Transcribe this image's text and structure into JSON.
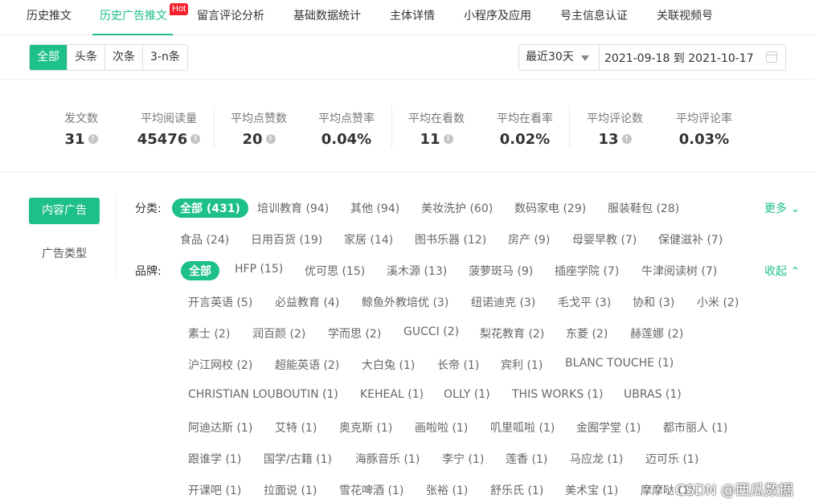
{
  "top_tabs": [
    "历史推文",
    "历史广告推文",
    "留言评论分析",
    "基础数据统计",
    "主体详情",
    "小程序及应用",
    "号主信息认证",
    "关联视频号"
  ],
  "hot_badge": "Hot",
  "segment": [
    "全部",
    "头条",
    "次条",
    "3-n条"
  ],
  "date": {
    "preset": "最近30天",
    "range": "2021-09-18 到 2021-10-17"
  },
  "stats": [
    {
      "label": "发文数",
      "value": "31"
    },
    {
      "label": "平均阅读量",
      "value": "45476"
    },
    {
      "label": "平均点赞数",
      "value": "20"
    },
    {
      "label": "平均点赞率",
      "value": "0.04%"
    },
    {
      "label": "平均在看数",
      "value": "11"
    },
    {
      "label": "平均在看率",
      "value": "0.02%"
    },
    {
      "label": "平均评论数",
      "value": "13"
    },
    {
      "label": "平均评论率",
      "value": "0.03%"
    }
  ],
  "info_icon": "!",
  "left": {
    "ad_btn": "内容广告",
    "ad_type": "广告类型"
  },
  "category": {
    "label": "分类:",
    "more": "更多",
    "items": [
      "全部 (431)",
      "培训教育 (94)",
      "其他 (94)",
      "美妆洗护 (60)",
      "数码家电 (29)",
      "服装鞋包 (28)",
      "食品 (24)",
      "日用百货 (19)",
      "家居 (14)",
      "图书乐器 (12)",
      "房产 (9)",
      "母婴早教 (7)",
      "保健滋补 (7)"
    ]
  },
  "brand": {
    "label": "品牌:",
    "collapse": "收起",
    "items": [
      "全部",
      "HFP (15)",
      "优可思 (15)",
      "溪木源 (13)",
      "菠萝斑马 (9)",
      "插座学院 (7)",
      "牛津阅读树 (7)",
      "开言英语 (5)",
      "必益教育 (4)",
      "鲸鱼外教培优 (3)",
      "纽诺迪克 (3)",
      "毛戈平 (3)",
      "协和 (3)",
      "小米 (2)",
      "素士 (2)",
      "润百颜 (2)",
      "学而思 (2)",
      "GUCCI (2)",
      "梨花教育 (2)",
      "东菱 (2)",
      "赫莲娜 (2)",
      "沪江网校 (2)",
      "超能英语 (2)",
      "大白兔 (1)",
      "长帝 (1)",
      "宾利 (1)",
      "BLANC TOUCHE (1)",
      "CHRISTIAN LOUBOUTIN (1)",
      "KEHEAL (1)",
      "OLLY (1)",
      "THIS WORKS (1)",
      "UBRAS (1)",
      "阿迪达斯 (1)",
      "艾特 (1)",
      "奥克斯 (1)",
      "画啦啦 (1)",
      "叽里呱啦 (1)",
      "金囿学堂 (1)",
      "都市丽人 (1)",
      "跟谁学 (1)",
      "国学/古籍 (1)",
      "海豚音乐 (1)",
      "李宁 (1)",
      "莲香 (1)",
      "马应龙 (1)",
      "迈可乐 (1)",
      "开课吧 (1)",
      "拉面说 (1)",
      "雪花啤酒 (1)",
      "张裕 (1)",
      "舒乐氏 (1)",
      "美术宝 (1)",
      "摩摩哒 (1)"
    ]
  },
  "watermark": "CSDN @西瓜数据"
}
